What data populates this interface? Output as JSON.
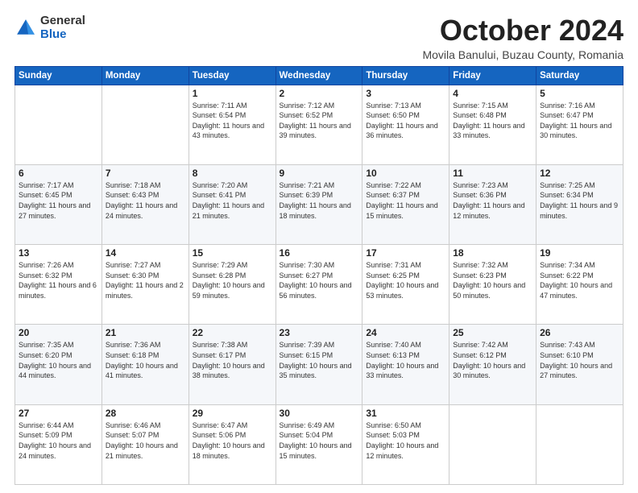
{
  "header": {
    "logo": {
      "general": "General",
      "blue": "Blue"
    },
    "title": "October 2024",
    "subtitle": "Movila Banului, Buzau County, Romania"
  },
  "days_of_week": [
    "Sunday",
    "Monday",
    "Tuesday",
    "Wednesday",
    "Thursday",
    "Friday",
    "Saturday"
  ],
  "weeks": [
    [
      {
        "day": "",
        "sunrise": "",
        "sunset": "",
        "daylight": ""
      },
      {
        "day": "",
        "sunrise": "",
        "sunset": "",
        "daylight": ""
      },
      {
        "day": "1",
        "sunrise": "Sunrise: 7:11 AM",
        "sunset": "Sunset: 6:54 PM",
        "daylight": "Daylight: 11 hours and 43 minutes."
      },
      {
        "day": "2",
        "sunrise": "Sunrise: 7:12 AM",
        "sunset": "Sunset: 6:52 PM",
        "daylight": "Daylight: 11 hours and 39 minutes."
      },
      {
        "day": "3",
        "sunrise": "Sunrise: 7:13 AM",
        "sunset": "Sunset: 6:50 PM",
        "daylight": "Daylight: 11 hours and 36 minutes."
      },
      {
        "day": "4",
        "sunrise": "Sunrise: 7:15 AM",
        "sunset": "Sunset: 6:48 PM",
        "daylight": "Daylight: 11 hours and 33 minutes."
      },
      {
        "day": "5",
        "sunrise": "Sunrise: 7:16 AM",
        "sunset": "Sunset: 6:47 PM",
        "daylight": "Daylight: 11 hours and 30 minutes."
      }
    ],
    [
      {
        "day": "6",
        "sunrise": "Sunrise: 7:17 AM",
        "sunset": "Sunset: 6:45 PM",
        "daylight": "Daylight: 11 hours and 27 minutes."
      },
      {
        "day": "7",
        "sunrise": "Sunrise: 7:18 AM",
        "sunset": "Sunset: 6:43 PM",
        "daylight": "Daylight: 11 hours and 24 minutes."
      },
      {
        "day": "8",
        "sunrise": "Sunrise: 7:20 AM",
        "sunset": "Sunset: 6:41 PM",
        "daylight": "Daylight: 11 hours and 21 minutes."
      },
      {
        "day": "9",
        "sunrise": "Sunrise: 7:21 AM",
        "sunset": "Sunset: 6:39 PM",
        "daylight": "Daylight: 11 hours and 18 minutes."
      },
      {
        "day": "10",
        "sunrise": "Sunrise: 7:22 AM",
        "sunset": "Sunset: 6:37 PM",
        "daylight": "Daylight: 11 hours and 15 minutes."
      },
      {
        "day": "11",
        "sunrise": "Sunrise: 7:23 AM",
        "sunset": "Sunset: 6:36 PM",
        "daylight": "Daylight: 11 hours and 12 minutes."
      },
      {
        "day": "12",
        "sunrise": "Sunrise: 7:25 AM",
        "sunset": "Sunset: 6:34 PM",
        "daylight": "Daylight: 11 hours and 9 minutes."
      }
    ],
    [
      {
        "day": "13",
        "sunrise": "Sunrise: 7:26 AM",
        "sunset": "Sunset: 6:32 PM",
        "daylight": "Daylight: 11 hours and 6 minutes."
      },
      {
        "day": "14",
        "sunrise": "Sunrise: 7:27 AM",
        "sunset": "Sunset: 6:30 PM",
        "daylight": "Daylight: 11 hours and 2 minutes."
      },
      {
        "day": "15",
        "sunrise": "Sunrise: 7:29 AM",
        "sunset": "Sunset: 6:28 PM",
        "daylight": "Daylight: 10 hours and 59 minutes."
      },
      {
        "day": "16",
        "sunrise": "Sunrise: 7:30 AM",
        "sunset": "Sunset: 6:27 PM",
        "daylight": "Daylight: 10 hours and 56 minutes."
      },
      {
        "day": "17",
        "sunrise": "Sunrise: 7:31 AM",
        "sunset": "Sunset: 6:25 PM",
        "daylight": "Daylight: 10 hours and 53 minutes."
      },
      {
        "day": "18",
        "sunrise": "Sunrise: 7:32 AM",
        "sunset": "Sunset: 6:23 PM",
        "daylight": "Daylight: 10 hours and 50 minutes."
      },
      {
        "day": "19",
        "sunrise": "Sunrise: 7:34 AM",
        "sunset": "Sunset: 6:22 PM",
        "daylight": "Daylight: 10 hours and 47 minutes."
      }
    ],
    [
      {
        "day": "20",
        "sunrise": "Sunrise: 7:35 AM",
        "sunset": "Sunset: 6:20 PM",
        "daylight": "Daylight: 10 hours and 44 minutes."
      },
      {
        "day": "21",
        "sunrise": "Sunrise: 7:36 AM",
        "sunset": "Sunset: 6:18 PM",
        "daylight": "Daylight: 10 hours and 41 minutes."
      },
      {
        "day": "22",
        "sunrise": "Sunrise: 7:38 AM",
        "sunset": "Sunset: 6:17 PM",
        "daylight": "Daylight: 10 hours and 38 minutes."
      },
      {
        "day": "23",
        "sunrise": "Sunrise: 7:39 AM",
        "sunset": "Sunset: 6:15 PM",
        "daylight": "Daylight: 10 hours and 35 minutes."
      },
      {
        "day": "24",
        "sunrise": "Sunrise: 7:40 AM",
        "sunset": "Sunset: 6:13 PM",
        "daylight": "Daylight: 10 hours and 33 minutes."
      },
      {
        "day": "25",
        "sunrise": "Sunrise: 7:42 AM",
        "sunset": "Sunset: 6:12 PM",
        "daylight": "Daylight: 10 hours and 30 minutes."
      },
      {
        "day": "26",
        "sunrise": "Sunrise: 7:43 AM",
        "sunset": "Sunset: 6:10 PM",
        "daylight": "Daylight: 10 hours and 27 minutes."
      }
    ],
    [
      {
        "day": "27",
        "sunrise": "Sunrise: 6:44 AM",
        "sunset": "Sunset: 5:09 PM",
        "daylight": "Daylight: 10 hours and 24 minutes."
      },
      {
        "day": "28",
        "sunrise": "Sunrise: 6:46 AM",
        "sunset": "Sunset: 5:07 PM",
        "daylight": "Daylight: 10 hours and 21 minutes."
      },
      {
        "day": "29",
        "sunrise": "Sunrise: 6:47 AM",
        "sunset": "Sunset: 5:06 PM",
        "daylight": "Daylight: 10 hours and 18 minutes."
      },
      {
        "day": "30",
        "sunrise": "Sunrise: 6:49 AM",
        "sunset": "Sunset: 5:04 PM",
        "daylight": "Daylight: 10 hours and 15 minutes."
      },
      {
        "day": "31",
        "sunrise": "Sunrise: 6:50 AM",
        "sunset": "Sunset: 5:03 PM",
        "daylight": "Daylight: 10 hours and 12 minutes."
      },
      {
        "day": "",
        "sunrise": "",
        "sunset": "",
        "daylight": ""
      },
      {
        "day": "",
        "sunrise": "",
        "sunset": "",
        "daylight": ""
      }
    ]
  ]
}
